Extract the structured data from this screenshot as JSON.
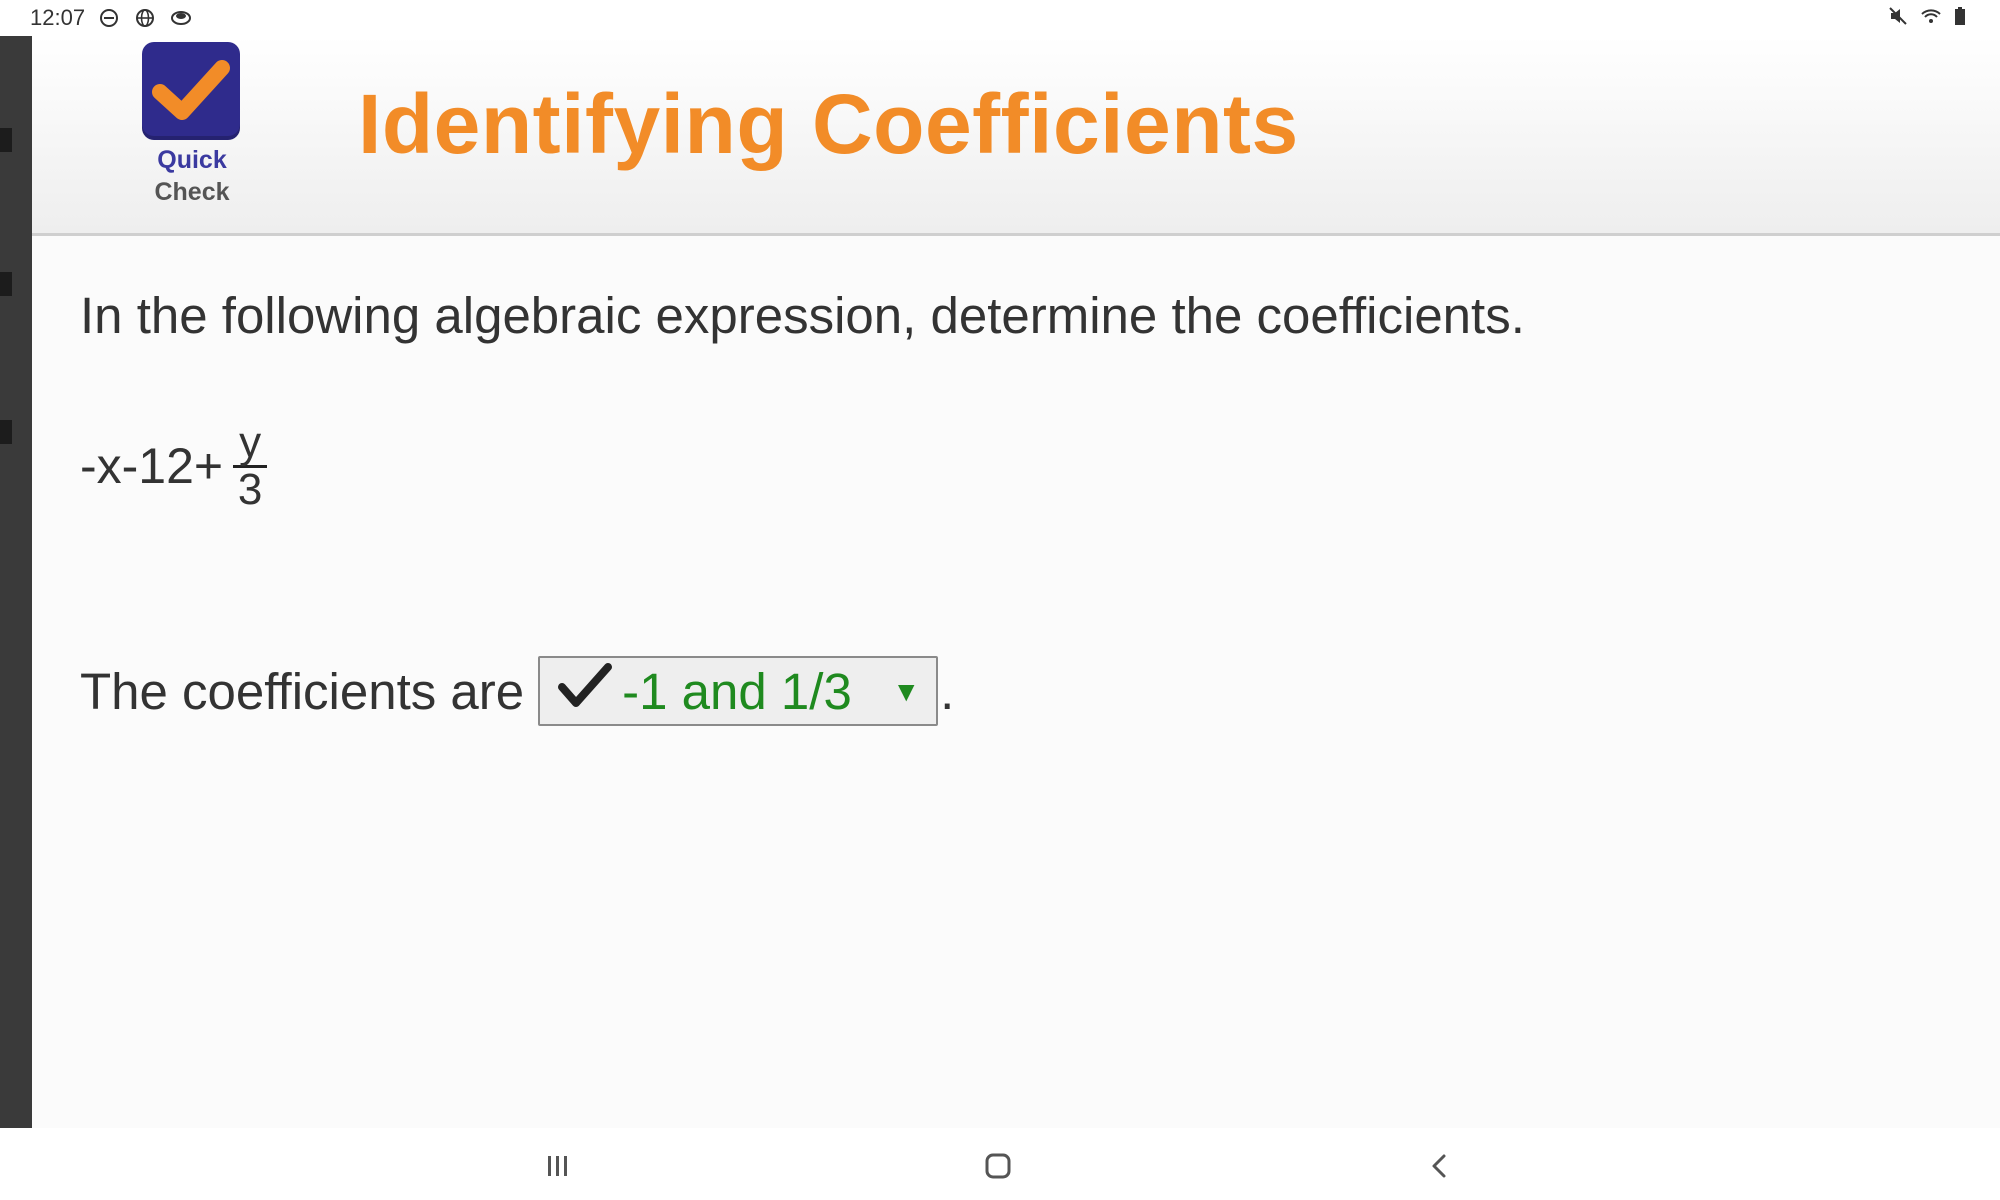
{
  "status_bar": {
    "time": "12:07",
    "left_icons": [
      "do-not-disturb-icon",
      "globe-icon",
      "cloud-icon"
    ],
    "right_icons": [
      "mute-icon",
      "wifi-icon",
      "battery-icon"
    ]
  },
  "header": {
    "logo_caption_line1": "Quick",
    "logo_caption_line2": "Check",
    "title": "Identifying Coefficients",
    "title_color": "#f28c28"
  },
  "content": {
    "question": "In the following algebraic expression, determine the coefficients.",
    "expression_prefix": "-x-12+",
    "fraction_numerator": "y",
    "fraction_denominator": "3",
    "answer_prefix": "The coefficients are",
    "selected_answer": "-1 and 1/3",
    "answer_suffix": "."
  },
  "navbar": {
    "buttons": [
      "recent-apps",
      "home",
      "back"
    ]
  }
}
